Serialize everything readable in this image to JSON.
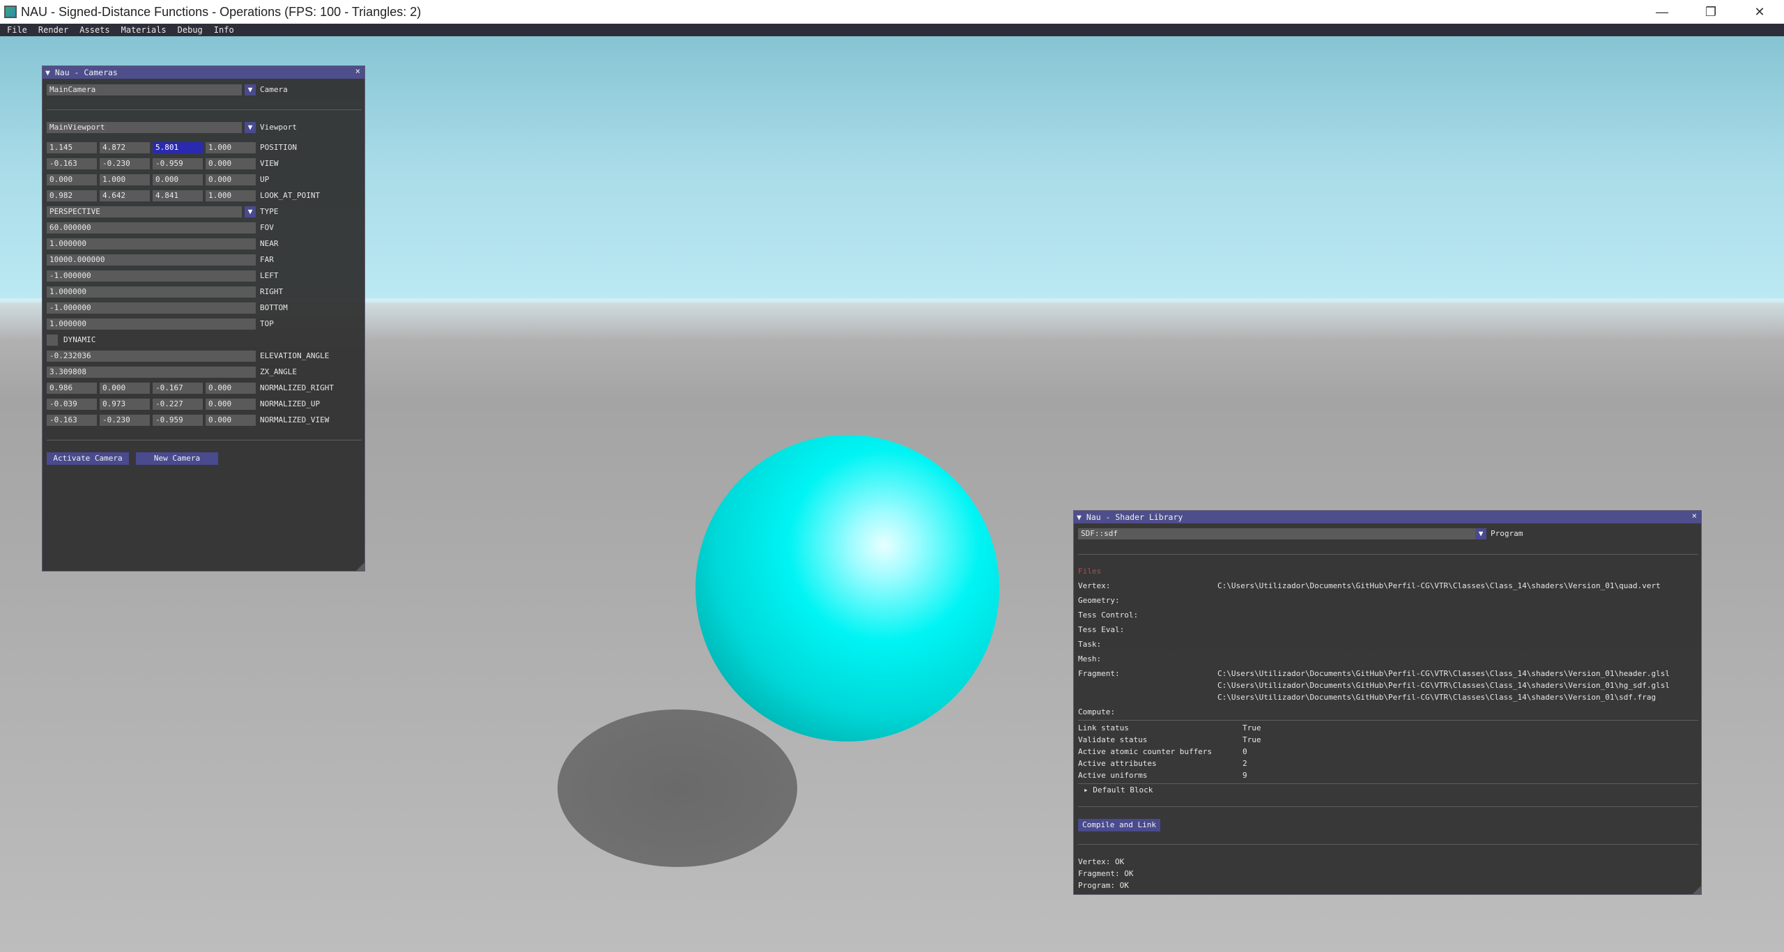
{
  "window": {
    "title": "NAU - Signed-Distance Functions - Operations (FPS: 100 - Triangles: 2)",
    "minimize": "—",
    "maximize": "❐",
    "close": "✕"
  },
  "menu": [
    "File",
    "Render",
    "Assets",
    "Materials",
    "Debug",
    "Info"
  ],
  "cameras_panel": {
    "title": "▼ Nau - Cameras",
    "close": "×",
    "camera_value": "MainCamera",
    "camera_label": "Camera",
    "viewport_value": "MainViewport",
    "viewport_label": "Viewport",
    "vectors": [
      {
        "label": "POSITION",
        "values": [
          "1.145",
          "4.872",
          "5.801",
          "1.000"
        ]
      },
      {
        "label": "VIEW",
        "values": [
          "-0.163",
          "-0.230",
          "-0.959",
          "0.000"
        ]
      },
      {
        "label": "UP",
        "values": [
          "0.000",
          "1.000",
          "0.000",
          "0.000"
        ]
      },
      {
        "label": "LOOK_AT_POINT",
        "values": [
          "0.982",
          "4.642",
          "4.841",
          "1.000"
        ]
      }
    ],
    "type_value": "PERSPECTIVE",
    "type_label": "TYPE",
    "scalars": [
      {
        "label": "FOV",
        "value": "60.000000"
      },
      {
        "label": "NEAR",
        "value": "1.000000"
      },
      {
        "label": "FAR",
        "value": "10000.000000"
      },
      {
        "label": "LEFT",
        "value": "-1.000000"
      },
      {
        "label": "RIGHT",
        "value": "1.000000"
      },
      {
        "label": "BOTTOM",
        "value": "-1.000000"
      },
      {
        "label": "TOP",
        "value": "1.000000"
      }
    ],
    "dynamic_label": "DYNAMIC",
    "angles": [
      {
        "label": "ELEVATION_ANGLE",
        "value": "-0.232036"
      },
      {
        "label": "ZX_ANGLE",
        "value": "3.309808"
      }
    ],
    "normalized": [
      {
        "label": "NORMALIZED_RIGHT",
        "values": [
          "0.986",
          "0.000",
          "-0.167",
          "0.000"
        ]
      },
      {
        "label": "NORMALIZED_UP",
        "values": [
          "-0.039",
          "0.973",
          "-0.227",
          "0.000"
        ]
      },
      {
        "label": "NORMALIZED_VIEW",
        "values": [
          "-0.163",
          "-0.230",
          "-0.959",
          "0.000"
        ]
      }
    ],
    "activate_button": "Activate Camera",
    "new_button": "New Camera"
  },
  "shader_panel": {
    "title": "▼ Nau - Shader Library",
    "close": "×",
    "program_value": "SDF::sdf",
    "program_label": "Program",
    "files_header": "Files",
    "files": [
      {
        "label": "Vertex:",
        "paths": [
          "C:\\Users\\Utilizador\\Documents\\GitHub\\Perfil-CG\\VTR\\Classes\\Class_14\\shaders\\Version_01\\quad.vert"
        ]
      },
      {
        "label": "Geometry:",
        "paths": []
      },
      {
        "label": "Tess Control:",
        "paths": []
      },
      {
        "label": "Tess Eval:",
        "paths": []
      },
      {
        "label": "Task:",
        "paths": []
      },
      {
        "label": "Mesh:",
        "paths": []
      },
      {
        "label": "Fragment:",
        "paths": [
          "C:\\Users\\Utilizador\\Documents\\GitHub\\Perfil-CG\\VTR\\Classes\\Class_14\\shaders\\Version_01\\header.glsl",
          "C:\\Users\\Utilizador\\Documents\\GitHub\\Perfil-CG\\VTR\\Classes\\Class_14\\shaders\\Version_01\\hg_sdf.glsl",
          "C:\\Users\\Utilizador\\Documents\\GitHub\\Perfil-CG\\VTR\\Classes\\Class_14\\shaders\\Version_01\\sdf.frag"
        ]
      },
      {
        "label": "Compute:",
        "paths": []
      }
    ],
    "status": [
      {
        "label": "Link status",
        "value": "True"
      },
      {
        "label": "Validate status",
        "value": "True"
      },
      {
        "label": "Active atomic counter buffers",
        "value": "0"
      },
      {
        "label": "Active attributes",
        "value": "2"
      },
      {
        "label": "Active uniforms",
        "value": "9"
      }
    ],
    "default_block": "▸ Default Block",
    "compile_button": "Compile and Link",
    "log": [
      "Vertex: OK",
      "Fragment: OK",
      "Program: OK"
    ]
  }
}
